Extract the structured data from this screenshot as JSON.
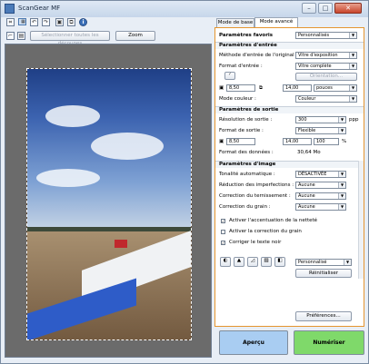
{
  "window": {
    "title": "ScanGear MF"
  },
  "toolbar": {
    "select_all_label": "Sélectionner toutes les découpes",
    "zoom_label": "Zoom"
  },
  "tabs": [
    {
      "label": "Mode de base"
    },
    {
      "label": "Mode avancé"
    }
  ],
  "favorites": {
    "label": "Paramètres favoris",
    "value": "Personnalisés"
  },
  "input_settings": {
    "header": "Paramètres d'entrée",
    "input_method_label": "Méthode d'entrée de l'original :",
    "input_method_value": "Vitre d'exposition",
    "input_size_label": "Format d'entrée :",
    "input_size_value": "Vitre complète",
    "orientation_label": "Orientation...",
    "width_value": "8,50",
    "height_value": "14,00",
    "unit_value": "pouces",
    "color_mode_label": "Mode couleur :",
    "color_mode_value": "Couleur"
  },
  "output_settings": {
    "header": "Paramètres de sortie",
    "resolution_label": "Résolution de sortie :",
    "resolution_value": "300",
    "resolution_unit": "ppp",
    "output_size_label": "Format de sortie :",
    "output_size_value": "Flexible",
    "width_value": "8,50",
    "height_value": "14,00",
    "scale_value": "100",
    "scale_unit": "%",
    "data_size_label": "Format des données :",
    "data_size_value": "30,64 Mo"
  },
  "image_settings": {
    "header": "Paramètres d'image",
    "auto_tone_label": "Tonalité automatique :",
    "auto_tone_value": "DÉSACTIVÉE",
    "reduce_imperfections_label": "Réduction des imperfections :",
    "reduce_imperfections_value": "Aucune",
    "fading_label": "Correction du ternissement :",
    "fading_value": "Aucune",
    "grain_label": "Correction du grain :",
    "grain_value": "Aucune",
    "unsharp_label": "Activer l'accentuation de la netteté",
    "unsharp_checked": true,
    "grain_correction_label": "Activer la correction du grain",
    "grain_correction_checked": false,
    "correct_black_text_label": "Corriger le texte noir",
    "correct_black_text_checked": true
  },
  "adjust": {
    "preset_value": "Personnalisé",
    "reset_label": "Réinitialiser"
  },
  "preferences_label": "Préférences...",
  "actions": {
    "preview_label": "Aperçu",
    "scan_label": "Numériser",
    "preview_color": "#a9cdf2",
    "scan_color": "#7fd96a"
  }
}
